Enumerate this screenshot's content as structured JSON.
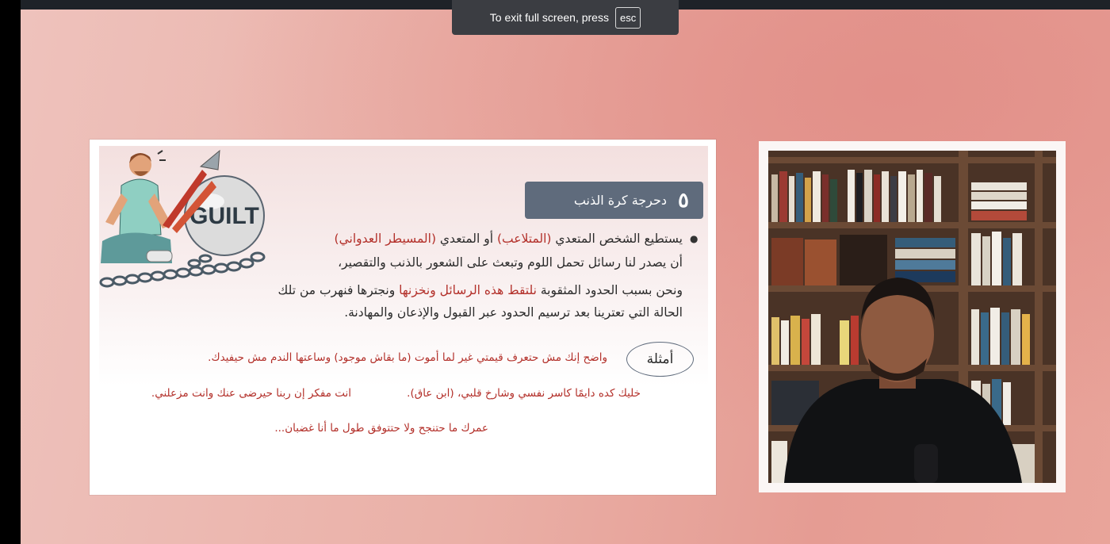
{
  "fullscreen_toast": {
    "message": "To exit full screen, press",
    "key": "esc"
  },
  "slide": {
    "title_number": "٥",
    "title": "دحرجة كرة الذنب",
    "illustration_word": "GUILT",
    "para1": {
      "t1": "يستطيع الشخص المتعدي ",
      "r1": "(المتلاعب)",
      "t2": " أو المتعدي ",
      "r2": "(المسيطر العدواني)"
    },
    "para1_line2": "أن يصدر لنا رسائل تحمل اللوم وتبعث على الشعور بالذنب والتقصير،",
    "para2": {
      "t1": "ونحن بسبب الحدود المثقوبة ",
      "r1": "نلتقط هذه الرسائل",
      "r2": " ونخزنها",
      "t2": " ونجترها فنهرب من تلك"
    },
    "para2_line2": "الحالة التي تعترينا بعد ترسيم الحدود عبر القبول والإذعان والمهادنة.",
    "examples_label": "أمثلة",
    "examples": [
      "واضح إنك مش حتعرف قيمتي غير لما أموت (ما بقاش موجود) وساعتها الندم مش حيفيدك.",
      "خليك كده دايمًا كاسر نفسي وشارخ قلبي، (ابن عاق).",
      "انت مفكر إن ربنا حيرضى عنك وانت مزعلني.",
      "عمرك ما حتنجح ولا حتتوفق طول ما أنا غضبان..."
    ]
  },
  "colors": {
    "title_box": "#5f6b7c",
    "accent_red": "#b3302a",
    "background": "#e9a9a0"
  }
}
